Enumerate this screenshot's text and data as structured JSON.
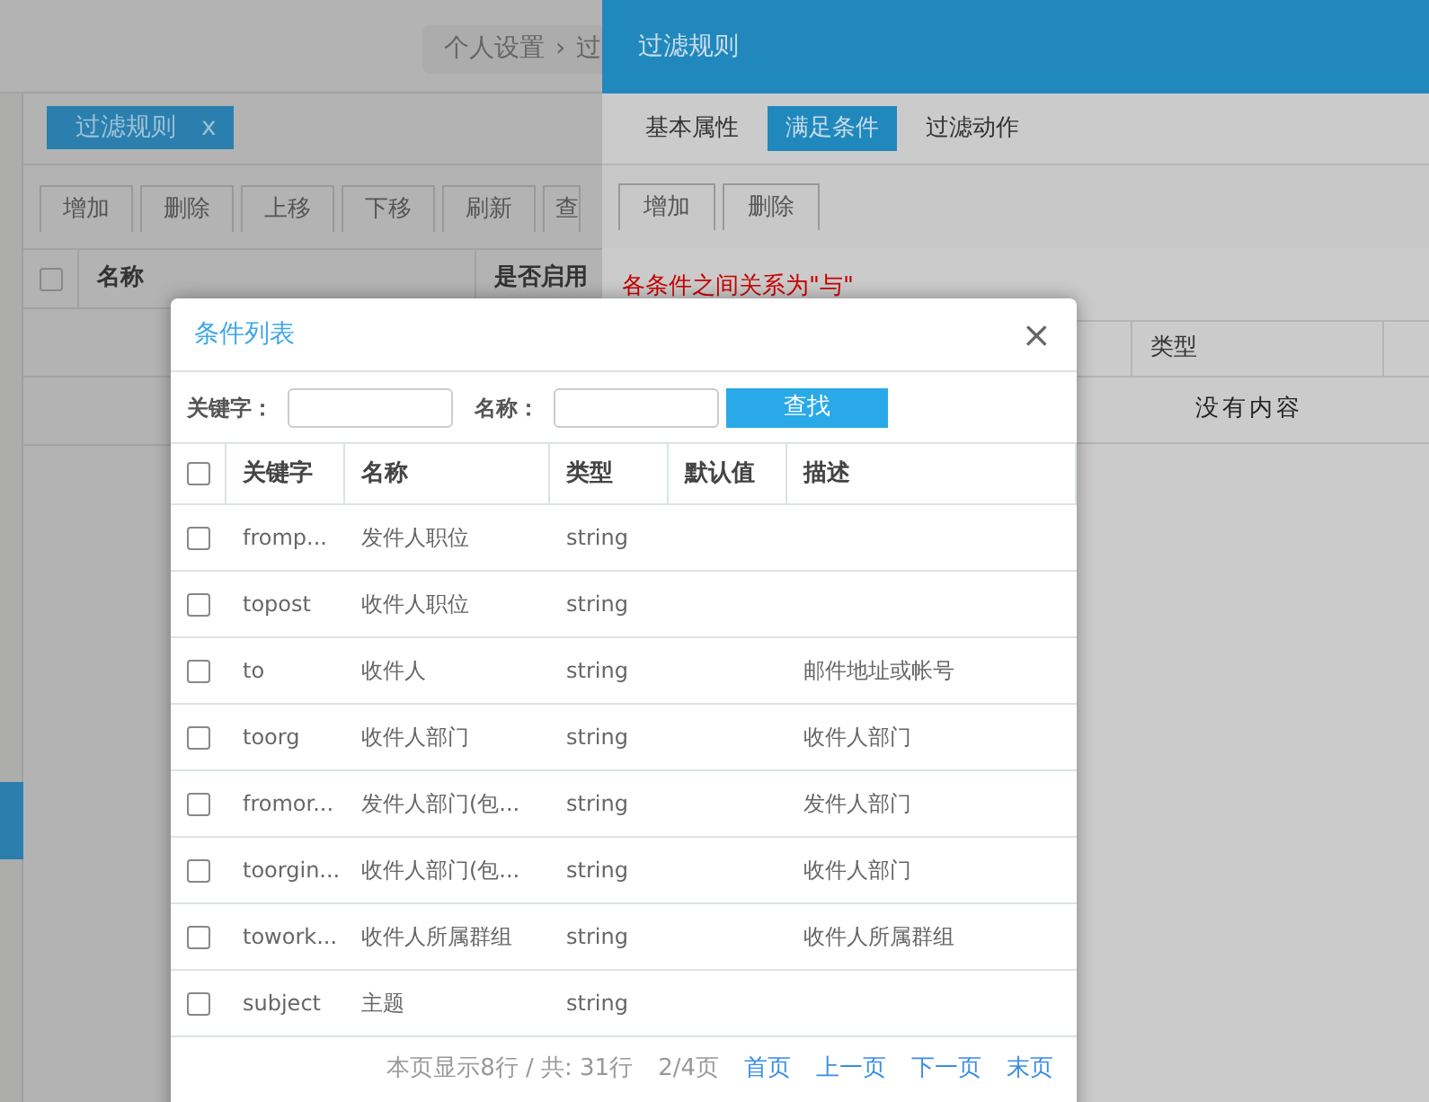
{
  "header": {
    "breadcrumb": [
      "个人设置",
      "›",
      "过"
    ]
  },
  "sidebar": {
    "items": [
      {
        "selected": true
      }
    ]
  },
  "page_tabs": [
    {
      "label": "过滤规则",
      "close": "x",
      "selected": true
    }
  ],
  "toolbar": [
    "增加",
    "删除",
    "上移",
    "下移",
    "刷新",
    "查"
  ],
  "table": {
    "header_checked": false,
    "columns": [
      "名称",
      "是否启用"
    ]
  },
  "panel": {
    "title": "过滤规则",
    "tabs": [
      {
        "label": "基本属性",
        "selected": false
      },
      {
        "label": "满足条件",
        "selected": true
      },
      {
        "label": "过滤动作",
        "selected": false
      }
    ],
    "toolbar": [
      "增加",
      "删除"
    ],
    "note": "各条件之间关系为\"与\"",
    "table": {
      "columns": [
        "类型"
      ],
      "empty_text": "没有内容"
    }
  },
  "dialog": {
    "title": "条件列表",
    "close": "×",
    "search": [
      {
        "label": "关键字："
      },
      {
        "label": "名称："
      }
    ],
    "search_button": "查找",
    "header_checked": false,
    "columns": [
      "关键字",
      "名称",
      "类型",
      "默认值",
      "描述"
    ],
    "rows": [
      {
        "checked": false,
        "cells": [
          "fromp...",
          "发件人职位",
          "string",
          "",
          ""
        ]
      },
      {
        "checked": false,
        "cells": [
          "topost",
          "收件人职位",
          "string",
          "",
          ""
        ]
      },
      {
        "checked": false,
        "cells": [
          "to",
          "收件人",
          "string",
          "",
          "邮件地址或帐号"
        ]
      },
      {
        "checked": false,
        "cells": [
          "toorg",
          "收件人部门",
          "string",
          "",
          "收件人部门"
        ]
      },
      {
        "checked": false,
        "cells": [
          "fromor...",
          "发件人部门(包...",
          "string",
          "",
          "发件人部门"
        ]
      },
      {
        "checked": false,
        "cells": [
          "toorgin...",
          "收件人部门(包...",
          "string",
          "",
          "收件人部门"
        ]
      },
      {
        "checked": false,
        "cells": [
          "towork...",
          "收件人所属群组",
          "string",
          "",
          "收件人所属群组"
        ]
      },
      {
        "checked": false,
        "cells": [
          "subject",
          "主题",
          "string",
          "",
          ""
        ]
      }
    ],
    "pagination": {
      "summary": "本页显示8行 / 共: 31行",
      "page": "2/4页",
      "links": [
        "首页",
        "上一页",
        "下一页",
        "末页"
      ]
    }
  }
}
